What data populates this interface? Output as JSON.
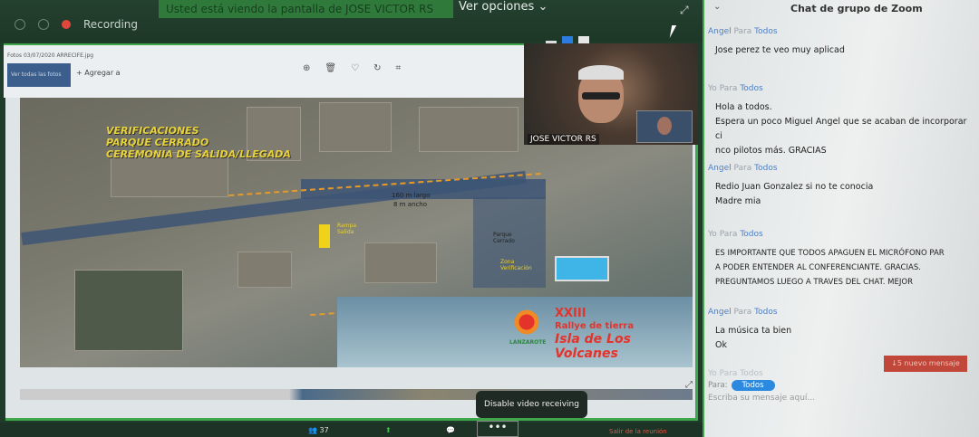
{
  "topbar": {
    "recording_label": "Recording",
    "share_banner": "Usted está viendo la pantalla de JOSE VICTOR RS",
    "view_options": "Ver opciones"
  },
  "viewer": {
    "filename": "Fotos 03/07/2020 ARRECIFE.jpg",
    "view_all": "Ver todas las fotos",
    "add_to": "Agregar a"
  },
  "map": {
    "title_lines": [
      "VERIFICACIONES",
      "PARQUE CERRADO",
      "CEREMONIA DE SALIDA/LLEGADA"
    ],
    "length": "160 m largo",
    "width": "8 m ancho",
    "ramp": "Rampa Salida",
    "parc": "Parque Cerrado",
    "verif": "Zona Verificación",
    "logo": {
      "edition": "XXIII",
      "line1": "Rallye de tierra",
      "line2": "Isla de Los Volcanes",
      "org": "LANZAROTE"
    }
  },
  "video": {
    "participant": "JOSE VICTOR RS"
  },
  "tooltip": "Disable video receiving",
  "toolbar": {
    "participants_count": "37",
    "more": "•••",
    "leave": "Salir de la reunión"
  },
  "chat": {
    "title": "Chat de grupo de Zoom",
    "messages": [
      {
        "sender": "Angel",
        "para": "Para",
        "to": "Todos",
        "lines": [
          "Jose perez te veo muy aplicad"
        ]
      },
      {
        "sender": "Yo",
        "para": "Para",
        "to": "Todos",
        "lines": [
          "Hola a todos.",
          "Espera un poco Miguel Angel que se acaban de incorporar ci",
          "nco pilotos más. GRACIAS"
        ]
      },
      {
        "sender": "Angel",
        "para": "Para",
        "to": "Todos",
        "lines": [
          "Redio Juan Gonzalez si no te conocia",
          "Madre mia"
        ]
      },
      {
        "sender": "Yo",
        "para": "Para",
        "to": "Todos",
        "lines": [
          "ES IMPORTANTE QUE TODOS APAGUEN EL MICRÓFONO PAR",
          "A PODER ENTENDER AL CONFERENCIANTE. GRACIAS.",
          "PREGUNTAMOS LUEGO A TRAVES DEL CHAT. MEJOR"
        ]
      },
      {
        "sender": "Angel",
        "para": "Para",
        "to": "Todos",
        "lines": [
          "La música ta bien",
          "Ok"
        ]
      }
    ],
    "new_message": "↓5 nuevo mensaje",
    "last_sender": "Yo Para Todos",
    "to_label": "Para:",
    "to_value": "Todos",
    "placeholder": "Escriba su mensaje aquí..."
  },
  "colors": {
    "zoom_green": "#3fa64a",
    "accent_blue": "#2b8ae0",
    "alert_red": "#c0473a"
  }
}
